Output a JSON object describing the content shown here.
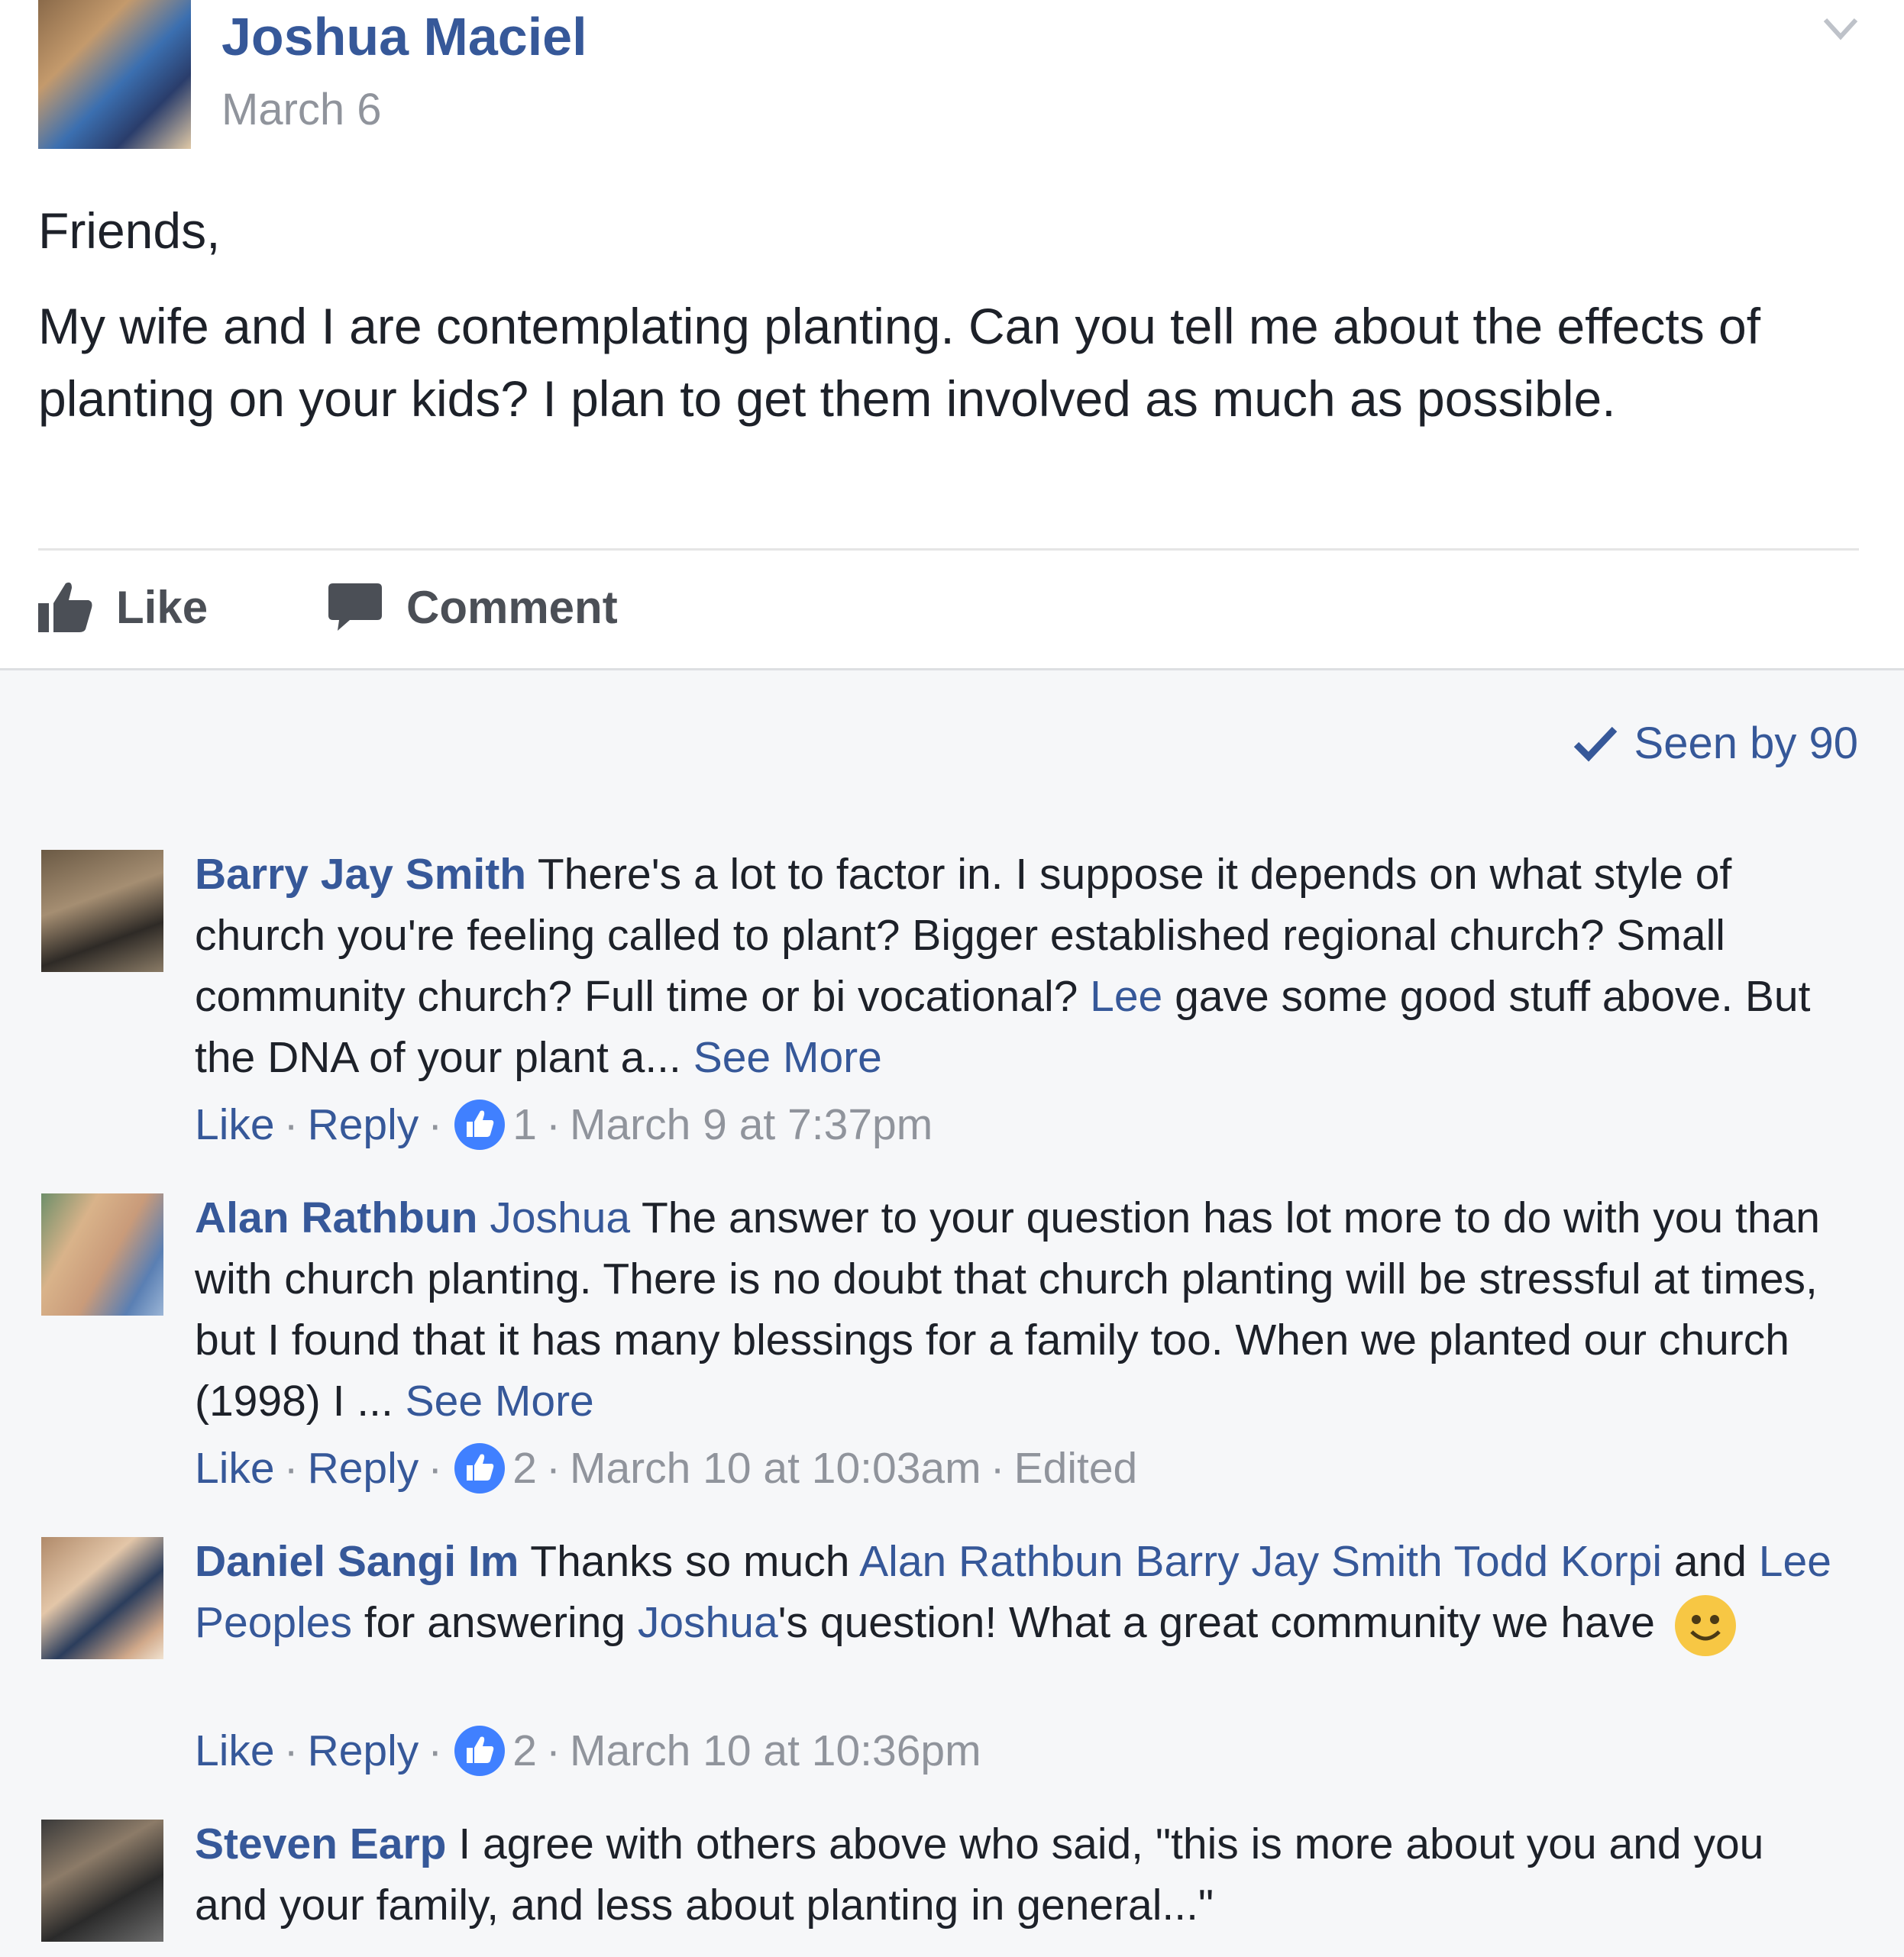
{
  "post": {
    "author": "Joshua Maciel",
    "date": "March 6",
    "greeting": "Friends,",
    "body": "My wife and I are contemplating planting. Can you tell me about the effects of planting on your kids? I plan to get them involved as much as possible.",
    "actions": {
      "like": "Like",
      "comment": "Comment"
    }
  },
  "seen": {
    "label": "Seen by 90"
  },
  "comments": [
    {
      "author": "Barry Jay Smith",
      "text1": " There's a lot to factor in. I suppose it depends on what style of church you're feeling called to plant? Bigger established regional church? Small community church? Full time or bi vocational? ",
      "mention1": "Lee",
      "text2": " gave some good stuff above. But the DNA of your plant a... ",
      "see_more": "See More",
      "like": "Like",
      "reply": "Reply",
      "reactions": "1",
      "timestamp": "March 9 at 7:37pm"
    },
    {
      "author": "Alan Rathbun",
      "mention1": "Joshua",
      "text1": " The answer to your question has lot more to do with you than with church planting. There is no doubt that church planting will be stressful at times, but I found that it has many blessings for a family too. When we planted our church (1998) I ... ",
      "see_more": "See More",
      "like": "Like",
      "reply": "Reply",
      "reactions": "2",
      "timestamp": "March 10 at 10:03am",
      "edited": "Edited"
    },
    {
      "author": "Daniel Sangi Im",
      "text1": " Thanks so much ",
      "mention1": "Alan Rathbun",
      "mention2": "Barry Jay Smith",
      "mention3": "Todd Korpi",
      "text2": " and ",
      "mention4": "Lee Peoples",
      "text3": " for answering ",
      "mention5": "Joshua",
      "text4": "'s question! What a great community we have ",
      "like": "Like",
      "reply": "Reply",
      "reactions": "2",
      "timestamp": "March 10 at 10:36pm"
    },
    {
      "author": "Steven Earp",
      "text1": " I agree with others above who said, \"this is more about you and you and your family, and less about planting in general...\""
    }
  ],
  "colors": {
    "link": "#365899",
    "meta": "#90949c",
    "text": "#1d2129",
    "comments_bg": "#f6f7f9",
    "like_badge": "#4080ff"
  }
}
